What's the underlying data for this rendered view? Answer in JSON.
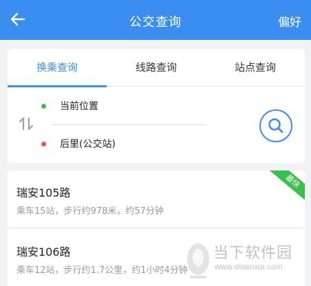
{
  "header": {
    "title": "公交查询",
    "preference_label": "偏好"
  },
  "tabs": [
    {
      "label": "换乘查询",
      "active": true
    },
    {
      "label": "线路查询",
      "active": false
    },
    {
      "label": "站点查询",
      "active": false
    }
  ],
  "transfer_search": {
    "from_value": "当前位置",
    "to_value": "后里(公交站)"
  },
  "results": [
    {
      "name": "瑞安105路",
      "info": "乘车15站，步行约978米，约57分钟",
      "badge": "最快"
    },
    {
      "name": "瑞安106路",
      "info": "乘车12站，步行约1.7公里，约1小时4分钟"
    }
  ],
  "watermark": {
    "text": "当下软件园",
    "url": "www.downxia.com"
  },
  "colors": {
    "primary": "#3b8ef0",
    "start_dot": "#3cbf4e",
    "end_dot": "#ef4c4c",
    "badge": "#3cbf4e"
  },
  "icons": {
    "back": "back-arrow-icon",
    "swap": "swap-icon",
    "search": "search-icon"
  }
}
